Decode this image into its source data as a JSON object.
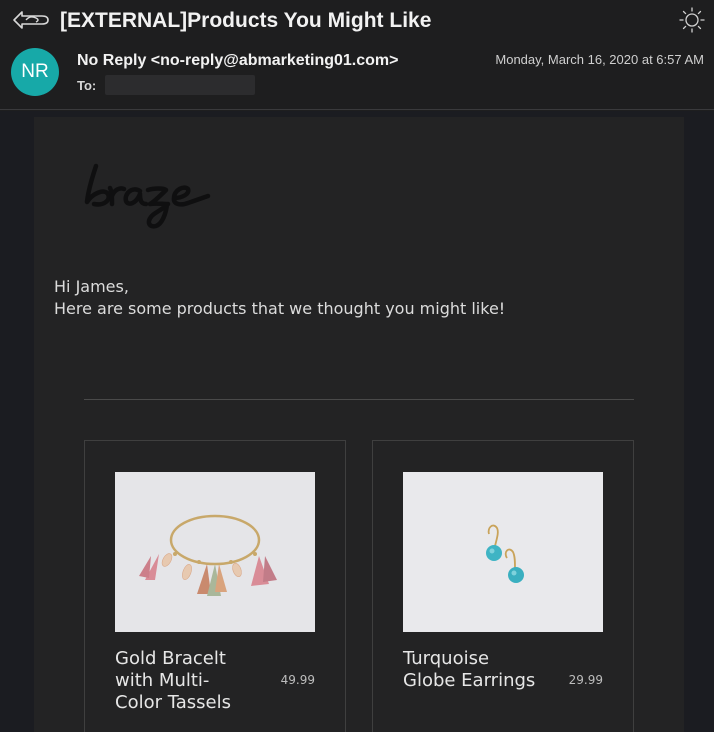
{
  "header": {
    "subject": "[EXTERNAL]Products You Might Like",
    "sender_initials": "NR",
    "from": "No Reply <no-reply@abmarketing01.com>",
    "to_label": "To:",
    "date": "Monday, March 16, 2020 at 6:57 AM"
  },
  "email": {
    "logo_text": "braze",
    "greeting": "Hi James,",
    "intro": "Here are some products that we thought you might like!",
    "products": [
      {
        "name": "Gold Bracelt with Multi-Color Tassels",
        "price": "49.99"
      },
      {
        "name": "Turquoise Globe Earrings",
        "price": "29.99"
      }
    ]
  },
  "colors": {
    "avatar": "#17a9a8",
    "background": "#1e1e1f",
    "card": "#232324"
  },
  "icons": [
    "reply-icon",
    "brightness-icon"
  ]
}
